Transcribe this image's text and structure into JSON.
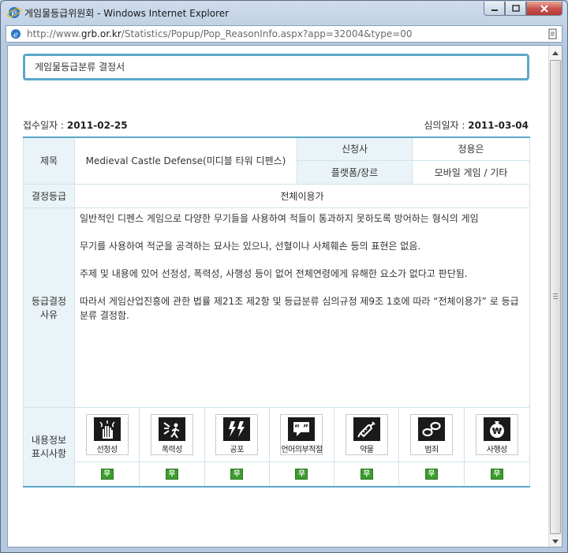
{
  "window": {
    "title": "게임물등급위원회 - Windows Internet Explorer",
    "url_prefix": "http://www.",
    "url_domain": "grb.or.kr",
    "url_rest": "/Statistics/Popup/Pop_ReasonInfo.aspx?app=32004&type=00"
  },
  "doc": {
    "title": "게임물등급분류 결정서",
    "received_label": "접수일자 : ",
    "received_value": "2011-02-25",
    "review_label": "심의일자 : ",
    "review_value": "2011-03-04"
  },
  "table": {
    "title_label": "제목",
    "title_value": "Medieval Castle Defense(미디블 타워 디펜스)",
    "applicant_label": "신청사",
    "applicant_value": "정용은",
    "platform_label": "플랫폼/장르",
    "platform_value": "모바일 게임 /  기타",
    "rating_label": "결정등급",
    "rating_value": "전체이용가",
    "reason_label_1": "등급결정",
    "reason_label_2": "사유",
    "reasons": [
      "일반적인 디펜스 게임으로 다양한 무기들을 사용하여 적들이 통과하지 못하도록 방어하는 형식의 게임",
      "무기를 사용하여 적군을 공격하는 묘사는 있으나, 선혈이나 사체훼손 등의 표현은 없음.",
      "주제 및 내용에 있어 선정성, 폭력성, 사행성 등이 없어 전체연령에게 유해한 요소가 없다고 판단됨.",
      "따라서 게임산업진흥에 관한 법률 제21조 제2항 및 등급분류 심의규정 제9조 1호에 따라 “전체이용가” 로 등급분류 결정함."
    ],
    "content_label_1": "내용정보",
    "content_label_2": "표시사항",
    "descriptors": [
      {
        "label": "선정성",
        "status": "무",
        "icon": "hand-icon"
      },
      {
        "label": "폭력성",
        "status": "무",
        "icon": "violence-icon"
      },
      {
        "label": "공포",
        "status": "무",
        "icon": "lightning-icon"
      },
      {
        "label": "언어의부적절",
        "status": "무",
        "icon": "speech-bubble-icon"
      },
      {
        "label": "약물",
        "status": "무",
        "icon": "syringe-icon"
      },
      {
        "label": "범죄",
        "status": "무",
        "icon": "handcuffs-icon"
      },
      {
        "label": "사행성",
        "status": "무",
        "icon": "money-bag-icon"
      }
    ]
  },
  "colors": {
    "accent": "#5ba8c9",
    "label_bg": "#eaf3f7",
    "badge": "#3c9c2e"
  }
}
